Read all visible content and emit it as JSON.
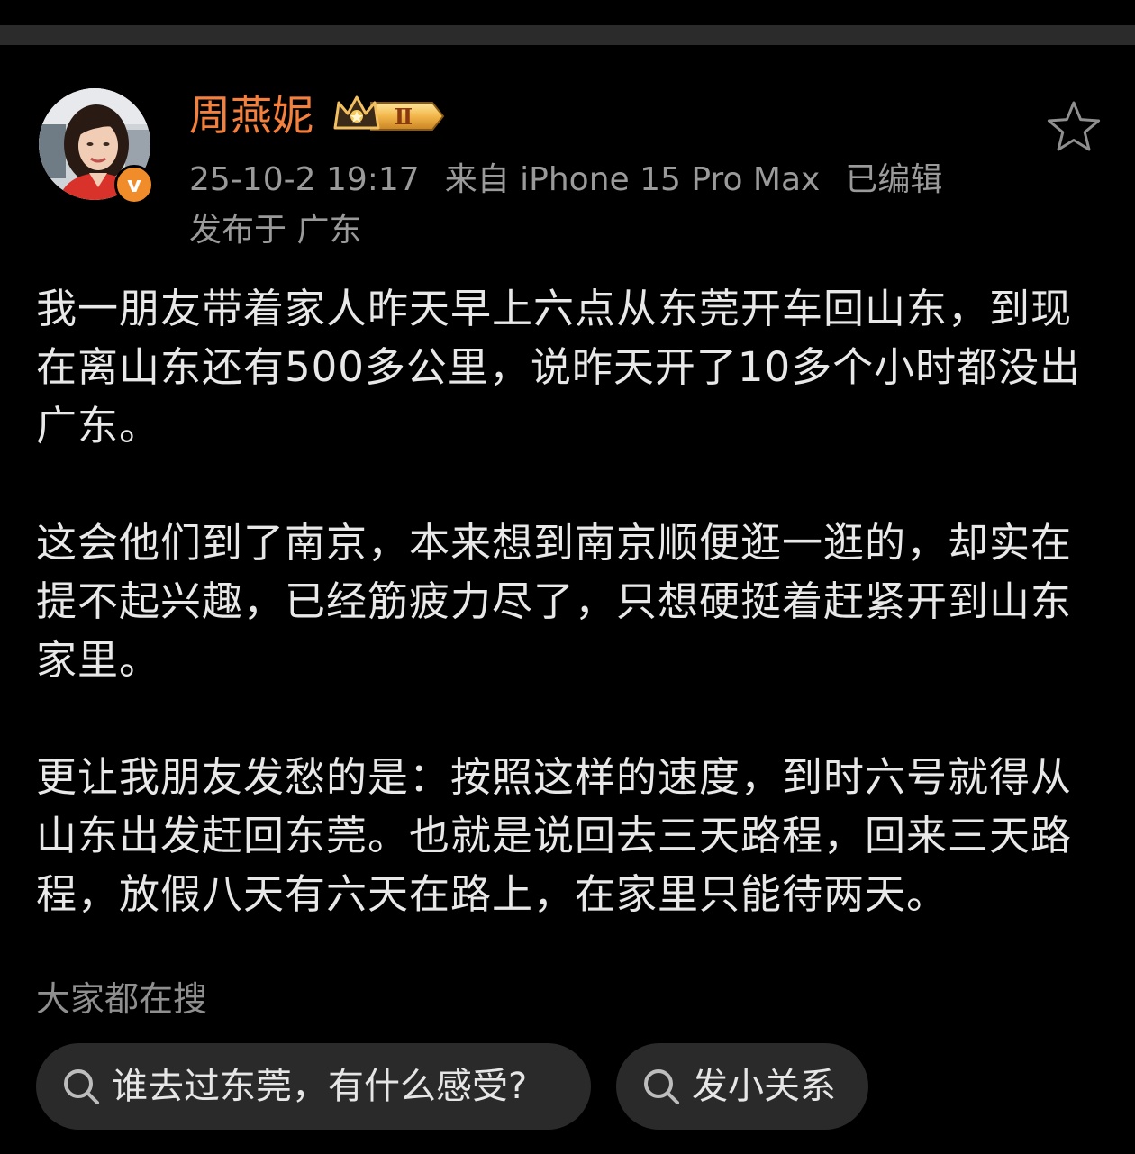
{
  "post": {
    "author": {
      "name": "周燕妮",
      "verified_icon": "v-verified-icon",
      "level_badge": "Ⅱ"
    },
    "meta": {
      "time": "25-10-2 19:17",
      "source": "来自 iPhone 15 Pro Max",
      "edited": "已编辑",
      "location": "发布于 广东"
    },
    "favorite_icon": "star-outline-icon",
    "paragraphs": [
      "我一朋友带着家人昨天早上六点从东莞开车回山东，到现在离山东还有500多公里，说昨天开了10多个小时都没出广东。",
      "这会他们到了南京，本来想到南京顺便逛一逛的，却实在提不起兴趣，已经筋疲力尽了，只想硬挺着赶紧开到山东家里。",
      "更让我朋友发愁的是：按照这样的速度，到时六号就得从山东出发赶回东莞。也就是说回去三天路程，回来三天路程，放假八天有六天在路上，在家里只能待两天。"
    ]
  },
  "search": {
    "title": "大家都在搜",
    "chips": [
      {
        "label": "谁去过东莞，有什么感受?",
        "icon": "search-icon"
      },
      {
        "label": "发小关系",
        "icon": "search-icon"
      }
    ]
  },
  "colors": {
    "username": "#f5803e",
    "badge_orange": "#f08c2a",
    "meta_gray": "#9a9a9a",
    "chip_bg": "#2a2a2a"
  }
}
